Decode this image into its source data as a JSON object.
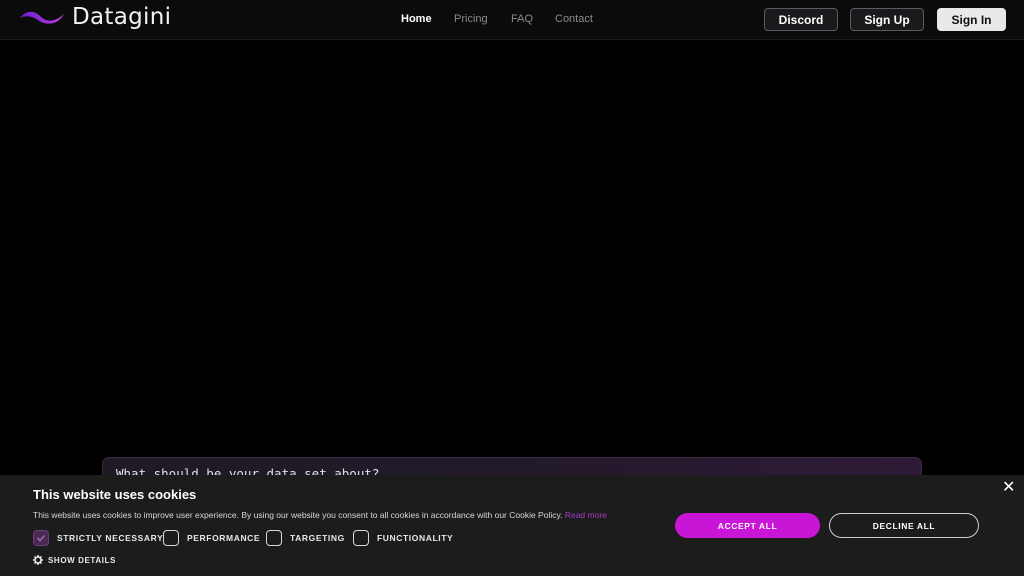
{
  "brand": {
    "name": "Datagini",
    "accent": "#c915d6"
  },
  "nav": {
    "items": [
      {
        "label": "Home",
        "active": true
      },
      {
        "label": "Pricing",
        "active": false
      },
      {
        "label": "FAQ",
        "active": false
      },
      {
        "label": "Contact",
        "active": false
      }
    ]
  },
  "header_buttons": {
    "discord": "Discord",
    "sign_up": "Sign Up",
    "sign_in": "Sign In"
  },
  "prompt": {
    "placeholder": "What should be your data set about?"
  },
  "cookie": {
    "title": "This website uses cookies",
    "description": "This website uses cookies to improve user experience. By using our website you consent to all cookies in accordance with our Cookie Policy.",
    "read_more": "Read more",
    "options": [
      {
        "label": "STRICTLY NECESSARY",
        "checked": true
      },
      {
        "label": "PERFORMANCE",
        "checked": false
      },
      {
        "label": "TARGETING",
        "checked": false
      },
      {
        "label": "FUNCTIONALITY",
        "checked": false
      }
    ],
    "show_details": "SHOW DETAILS",
    "accept_all": "ACCEPT ALL",
    "decline_all": "DECLINE ALL",
    "close_icon": "close-icon",
    "details_icon": "gear-icon"
  }
}
